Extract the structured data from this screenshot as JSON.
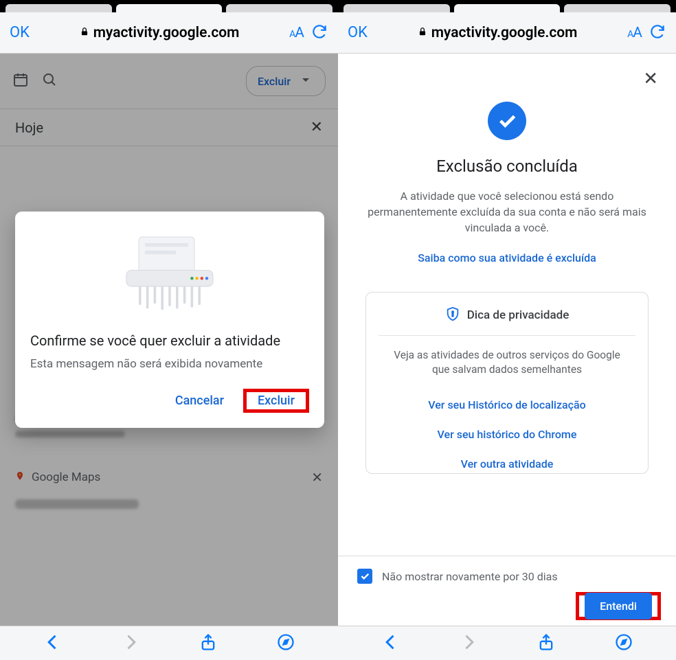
{
  "browser": {
    "ok_label": "OK",
    "url": "myactivity.google.com",
    "aa_small": "A",
    "aa_big": "A"
  },
  "left": {
    "excluir_chip": "Excluir",
    "section_title": "Hoje",
    "gmaps_label": "Google Maps",
    "dialog": {
      "title": "Confirme se você quer excluir a atividade",
      "subtitle": "Esta mensagem não será exibida novamente",
      "cancel": "Cancelar",
      "confirm": "Excluir"
    }
  },
  "right": {
    "title": "Exclusão concluída",
    "desc": "A atividade que você selecionou está sendo permanentemente excluída da sua conta e não será mais vinculada a você.",
    "learn_link": "Saiba como sua atividade é excluída",
    "tip": {
      "title": "Dica de privacidade",
      "body": "Veja as atividades de outros serviços do Google que salvam dados semelhantes",
      "link1": "Ver seu Histórico de localização",
      "link2": "Ver seu histórico do Chrome",
      "link3": "Ver outra atividade"
    },
    "checkbox_label": "Não mostrar novamente por 30 dias",
    "entendi": "Entendi"
  }
}
